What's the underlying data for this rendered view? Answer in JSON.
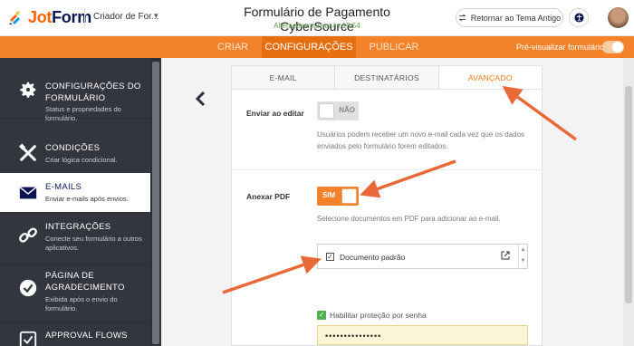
{
  "app": {
    "logo_jot": "Jot",
    "logo_form": "Form",
    "creator_label": "Criador de For...",
    "form_title": "Formulário de Pagamento CyberSource",
    "saved_status": "Alterações salvas às 19:54",
    "old_theme_button": "Retornar ao Tema Antigo",
    "brand_color": "#f3822a"
  },
  "nav": {
    "tabs": [
      "CRIAR",
      "CONFIGURAÇÕES",
      "PUBLICAR"
    ],
    "active_tab": "CONFIGURAÇÕES",
    "preview_label": "Pré-visualizar formulário"
  },
  "sidebar": {
    "items": [
      {
        "title_line1": "CONFIGURAÇÕES DO",
        "title_line2": "FORMULÁRIO",
        "desc": "Status e propriedades do formulário.",
        "icon": "gear-icon"
      },
      {
        "title_line1": "CONDIÇÕES",
        "title_line2": "",
        "desc": "Criar lógica condicional.",
        "icon": "tools-icon"
      },
      {
        "title_line1": "E-MAILS",
        "title_line2": "",
        "desc": "Enviar e-mails após envios.",
        "icon": "envelope-icon",
        "active": true
      },
      {
        "title_line1": "INTEGRAÇÕES",
        "title_line2": "",
        "desc": "Conecte seu formulário a outros aplicativos.",
        "icon": "link-icon"
      },
      {
        "title_line1": "PÁGINA DE",
        "title_line2": "AGRADECIMENTO",
        "desc": "Exibida após o envio do formulário.",
        "icon": "check-circle-icon"
      },
      {
        "title_line1": "APPROVAL FLOWS",
        "title_line2": "",
        "desc": "",
        "icon": "approval-icon"
      }
    ]
  },
  "email_tabs": {
    "tabs": [
      "E-MAIL",
      "DESTINATÁRIOS",
      "AVANÇADO"
    ],
    "active": "AVANÇADO"
  },
  "settings": {
    "send_on_edit": {
      "label": "Enviar ao editar",
      "toggle_text": "NÃO",
      "help": "Usuários podem receber um novo e-mail cada vez que os dados enviados pelo formulário forem editados."
    },
    "attach_pdf": {
      "label": "Anexar PDF",
      "toggle_text": "SIM",
      "help": "Selecione documentos em PDF para adicionar ao e-mail."
    },
    "document": {
      "label": "Documento padrão",
      "checked": true
    },
    "password": {
      "label": "Habilitar proteção por senha",
      "checked": true,
      "value": "•••••••••••••••"
    }
  },
  "annotation_color": "#e86a3a"
}
